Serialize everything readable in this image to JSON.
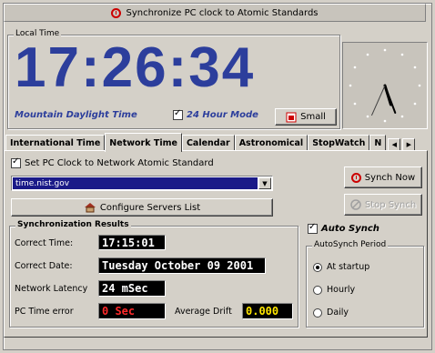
{
  "title_bar": {
    "title": "Synchronize PC clock to Atomic Standards",
    "icon": "clock-icon"
  },
  "local_time": {
    "group_label": "Local Time",
    "time": "17:26:34",
    "timezone": "Mountain Daylight Time",
    "hour_mode_label": "24 Hour Mode",
    "hour_mode_checked": true,
    "small_button": "Small",
    "clock_hands": {
      "hour": 5,
      "minute": 26,
      "second": 34
    }
  },
  "tabs": [
    {
      "label": "International Time",
      "active": false
    },
    {
      "label": "Network Time",
      "active": true
    },
    {
      "label": "Calendar",
      "active": false
    },
    {
      "label": "Astronomical",
      "active": false
    },
    {
      "label": "StopWatch",
      "active": false
    },
    {
      "label": "N",
      "active": false
    }
  ],
  "network": {
    "set_pc_clock_label": "Set PC Clock to Network Atomic Standard",
    "set_pc_clock_checked": true,
    "server": "time.nist.gov",
    "configure_button": "Configure Servers List",
    "synch_now_button": "Synch Now",
    "stop_synch_button": "Stop Synch"
  },
  "results": {
    "group_label": "Synchronization Results",
    "correct_time_label": "Correct Time:",
    "correct_time": "17:15:01",
    "correct_date_label": "Correct Date:",
    "correct_date": "Tuesday October 09 2001",
    "latency_label": "Network Latency",
    "latency": "24 mSec",
    "pc_error_label": "PC Time error",
    "pc_error": "0 Sec",
    "avg_drift_label": "Average Drift",
    "avg_drift": "0.000"
  },
  "autosynch": {
    "label": "Auto Synch",
    "checked": true,
    "period_label": "AutoSynch Period",
    "options": [
      "At startup",
      "Hourly",
      "Daily"
    ],
    "selected": "At startup"
  },
  "colors": {
    "accent_blue": "#2c3e9c",
    "error_red": "#ff2a2a",
    "drift_yellow": "#ffe600",
    "selection": "#1a1a88"
  }
}
